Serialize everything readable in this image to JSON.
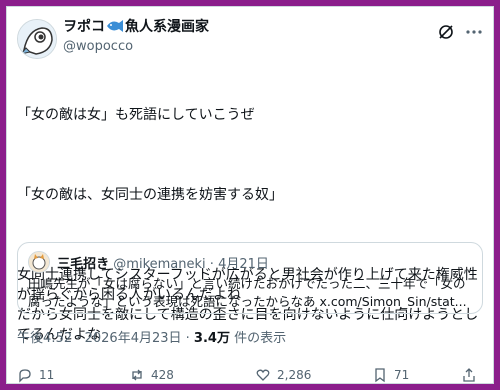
{
  "author": {
    "name_prefix": "ヲポコ",
    "name_suffix": "魚人系漫画家",
    "handle": "@wopocco"
  },
  "tweet": {
    "paragraphs": [
      "「女の敵は女」も死語にしていこうぜ",
      "「女の敵は、女同士の連携を妨害する奴」",
      "女同士連携してシスターフッドが広がると男社会が作り上げて来た権威性が揺らぐから困る人がいるんだよね\nだから女同士を敵にして構造の歪さに目を向けないように仕向けようとしてるんだよな"
    ]
  },
  "quote": {
    "name": "三毛招き",
    "handle": "@mikemaneki",
    "date": "4月21日",
    "text": "田嶋先生が「女は腐らない」と言い続けたおかげでたった二、三十年で「女の腐ったような」という表現は死語になったからなあ x.com/Simon_Sin/stat..."
  },
  "meta": {
    "time": "午後4:52",
    "date": "2026年4月23日",
    "views_count": "3.4万",
    "views_label": "件の表示"
  },
  "actions": {
    "replies": "11",
    "reposts": "428",
    "likes": "2,286",
    "bookmarks": "71"
  }
}
